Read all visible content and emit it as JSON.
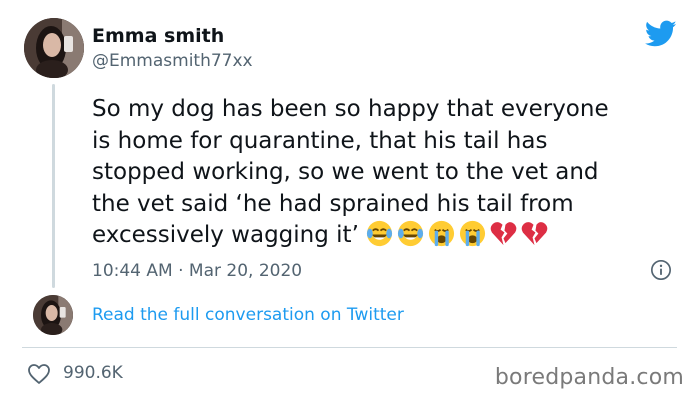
{
  "tweet": {
    "display_name": "Emma smith",
    "handle": "@Emmasmith77xx",
    "text_lines": [
      "So my dog has been so happy that everyone",
      "is home for quarantine, that his tail has",
      "stopped working, so we went to the vet and",
      "the vet said ‘he had sprained his tail from",
      "excessively wagging it’"
    ],
    "emojis": [
      "face-with-tears-of-joy",
      "face-with-tears-of-joy",
      "loudly-crying-face",
      "loudly-crying-face",
      "broken-heart",
      "broken-heart"
    ],
    "timestamp": "10:44 AM · Mar 20, 2020",
    "read_more_label": "Read the full conversation on Twitter",
    "like_count": "990.6K"
  },
  "brand": {
    "twitter_icon": "twitter-bird-icon",
    "watermark": "boredpanda.com",
    "accent_color": "#1d9bf0"
  }
}
